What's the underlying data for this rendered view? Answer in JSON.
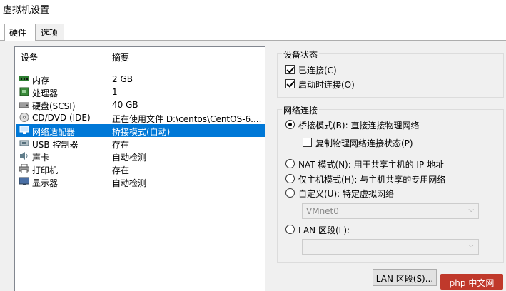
{
  "window": {
    "title": "虚拟机设置"
  },
  "tabs": [
    {
      "label": "硬件"
    },
    {
      "label": "选项"
    }
  ],
  "device_list": {
    "headers": {
      "device": "设备",
      "summary": "摘要"
    },
    "rows": [
      {
        "icon": "memory-icon",
        "name": "内存",
        "summary": "2 GB"
      },
      {
        "icon": "cpu-icon",
        "name": "处理器",
        "summary": "1"
      },
      {
        "icon": "harddisk-icon",
        "name": "硬盘(SCSI)",
        "summary": "40 GB"
      },
      {
        "icon": "cd-dvd-icon",
        "name": "CD/DVD (IDE)",
        "summary": "正在使用文件 D:\\centos\\CentOS-6...."
      },
      {
        "icon": "network-adapter-icon",
        "name": "网络适配器",
        "summary": "桥接模式(自动)"
      },
      {
        "icon": "usb-icon",
        "name": "USB 控制器",
        "summary": "存在"
      },
      {
        "icon": "sound-icon",
        "name": "声卡",
        "summary": "自动检测"
      },
      {
        "icon": "printer-icon",
        "name": "打印机",
        "summary": "存在"
      },
      {
        "icon": "monitor-icon",
        "name": "显示器",
        "summary": "自动检测"
      }
    ],
    "selected_index": 4
  },
  "device_status": {
    "title": "设备状态",
    "connected": {
      "label": "已连接(C)",
      "checked": true
    },
    "connect_at_power_on": {
      "label": "启动时连接(O)",
      "checked": true
    }
  },
  "network_connection": {
    "title": "网络连接",
    "bridged": {
      "label": "桥接模式(B): 直接连接物理网络",
      "checked": true
    },
    "replicate": {
      "label": "复制物理网络连接状态(P)",
      "checked": false
    },
    "nat": {
      "label": "NAT 模式(N): 用于共享主机的 IP 地址",
      "checked": false
    },
    "host_only": {
      "label": "仅主机模式(H): 与主机共享的专用网络",
      "checked": false
    },
    "custom": {
      "label": "自定义(U): 特定虚拟网络",
      "checked": false
    },
    "custom_value": "VMnet0",
    "lan_segment": {
      "label": "LAN 区段(L):",
      "checked": false
    },
    "lan_segment_value": ""
  },
  "buttons": {
    "lan_segments": "LAN 区段(S)..."
  },
  "watermark": "php 中文网",
  "colors": {
    "selection": "#0078d7",
    "panel": "#f0f0f0",
    "watermark": "#c0392b"
  }
}
